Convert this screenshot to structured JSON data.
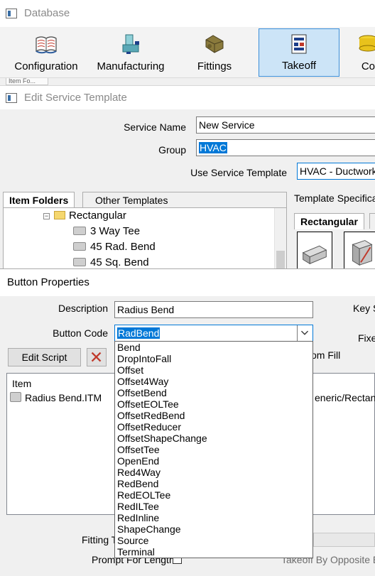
{
  "database_window": {
    "title": "Database",
    "ribbon": [
      {
        "label": "Configuration",
        "icon": "book-icon"
      },
      {
        "label": "Manufacturing",
        "icon": "machine-icon"
      },
      {
        "label": "Fittings",
        "icon": "fittings-icon"
      },
      {
        "label": "Takeoff",
        "icon": "takeoff-icon",
        "active": true
      },
      {
        "label": "Co",
        "icon": "coins-icon"
      }
    ],
    "subtab_label": "Item Fo..."
  },
  "edit_service_template": {
    "title": "Edit Service Template",
    "service_name_label": "Service Name",
    "service_name_value": "New Service",
    "group_label": "Group",
    "group_value": "HVAC",
    "use_template_label": "Use Service Template",
    "use_template_value": "HVAC - Ductwork_",
    "left_tabs": [
      "Item Folders",
      "Other Templates"
    ],
    "tree": [
      {
        "label": "Rectangular",
        "kind": "folder",
        "expanded": true
      },
      {
        "label": "3 Way Tee",
        "kind": "item"
      },
      {
        "label": "45 Rad. Bend",
        "kind": "item"
      },
      {
        "label": "45 Sq. Bend",
        "kind": "item"
      }
    ],
    "template_spec_label": "Template Specificat",
    "template_tabs": [
      "Rectangular"
    ]
  },
  "button_properties": {
    "title": "Button Properties",
    "description_label": "Description",
    "description_value": "Radius Bend",
    "button_code_label": "Button Code",
    "button_code_value": "RadBend",
    "key_label": "Key S",
    "fixed_label": "Fixe",
    "edit_script_label": "Edit Script",
    "custom_fill_label": "om Fill",
    "list_header": "Item",
    "list_rows": [
      {
        "name": "Radius Bend.ITM",
        "path": "eneric/Rectang"
      }
    ],
    "fitting_label": "Fitting T",
    "prompt_label": "Prompt For Length",
    "takeoff_label": "Takeoff By Opposite E",
    "dropdown_options": [
      "Bend",
      "DropIntoFall",
      "Offset",
      "Offset4Way",
      "OffsetBend",
      "OffsetEOLTee",
      "OffsetRedBend",
      "OffsetReducer",
      "OffsetShapeChange",
      "OffsetTee",
      "OpenEnd",
      "Red4Way",
      "RedBend",
      "RedEOLTee",
      "RedILTee",
      "RedInline",
      "ShapeChange",
      "Source",
      "Terminal"
    ]
  },
  "colors": {
    "accent": "#0078d7",
    "selection": "#cce4f7",
    "window_bg": "#f0f0f0"
  }
}
